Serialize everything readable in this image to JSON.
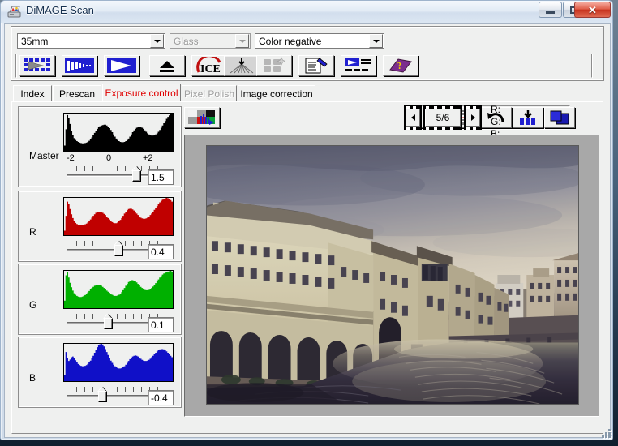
{
  "window": {
    "title": "DiMAGE Scan",
    "app_icon": "scanner-app-icon",
    "controls": {
      "minimize": "minimize-button",
      "maximize": "maximize-button",
      "close_glyph": "✕"
    }
  },
  "settings": {
    "film_format": {
      "value": "35mm",
      "enabled": true
    },
    "holder": {
      "value": "Glass",
      "enabled": false
    },
    "film_type": {
      "value": "Color negative",
      "enabled": true
    }
  },
  "main_toolbar": [
    {
      "name": "index-scan-button",
      "icon": "film-index-icon",
      "enabled": true
    },
    {
      "name": "prescan-button",
      "icon": "filmstrip-prescan-icon",
      "enabled": true
    },
    {
      "name": "scan-button",
      "icon": "scan-arrow-icon",
      "enabled": true
    },
    {
      "name": "eject-button",
      "icon": "eject-icon",
      "enabled": true
    },
    {
      "name": "digital-ice-button",
      "icon": "ice-icon",
      "enabled": true
    },
    {
      "name": "grain-dissolver-button",
      "icon": "grain-dissolver-icon",
      "enabled": true
    },
    {
      "name": "pixel-polish-button",
      "icon": "four-squares-sparkle-icon",
      "enabled": false
    },
    {
      "name": "job-save-button",
      "icon": "document-pen-icon",
      "enabled": true
    },
    {
      "name": "preferences-button",
      "icon": "settings-list-icon",
      "enabled": true
    },
    {
      "name": "help-button",
      "icon": "purple-help-book-icon",
      "enabled": true
    }
  ],
  "tabs": [
    {
      "label": "Index",
      "state": "normal"
    },
    {
      "label": "Prescan",
      "state": "normal"
    },
    {
      "label": "Exposure control",
      "state": "active"
    },
    {
      "label": "Pixel Polish",
      "state": "disabled"
    },
    {
      "label": "Image correction",
      "state": "normal"
    }
  ],
  "sub_toolbar": {
    "rgb_histogram_button": {
      "name": "rgb-histogram-button",
      "icon": "rgb-histogram-icon"
    },
    "buttons": [
      {
        "name": "load-job-button",
        "icon": "document-dropdown-icon"
      },
      {
        "name": "save-job-button",
        "icon": "document-arrow-icon"
      },
      {
        "name": "reset-button",
        "icon": "undo-arrow-icon"
      },
      {
        "name": "apply-button",
        "icon": "grid-download-icon"
      },
      {
        "name": "compare-button",
        "icon": "compare-panes-icon"
      }
    ]
  },
  "frame_nav": {
    "prev": "previous-frame-button",
    "next": "next-frame-button",
    "counter": "5/6"
  },
  "rgb_readout": {
    "r": "R:",
    "g": "G:",
    "b": "B:"
  },
  "channels": [
    {
      "id": "master",
      "label": "Master",
      "value": "1.5",
      "color": "#000000",
      "scale": {
        "min": "-2",
        "mid": "0",
        "max": "+2"
      },
      "thumb_pct": 73,
      "show_scale_labels": true,
      "histogram": [
        14,
        58,
        96,
        88,
        72,
        54,
        42,
        34,
        29,
        26,
        24,
        22,
        21,
        20,
        20,
        21,
        22,
        24,
        27,
        31,
        36,
        42,
        48,
        54,
        59,
        63,
        66,
        68,
        69,
        70,
        70,
        68,
        65,
        61,
        56,
        50,
        44,
        38,
        33,
        29,
        26,
        24,
        23,
        23,
        24,
        26,
        29,
        33,
        38,
        44,
        50,
        55,
        59,
        62,
        64,
        65,
        64,
        62,
        59,
        55,
        51,
        47,
        44,
        42,
        41,
        41,
        42,
        44,
        47,
        51,
        56,
        62,
        68,
        74,
        80,
        86,
        91,
        95,
        98,
        100
      ]
    },
    {
      "id": "r",
      "label": "R",
      "value": "0.4",
      "color": "#c00000",
      "thumb_pct": 55,
      "show_scale_labels": false,
      "histogram": [
        12,
        52,
        90,
        84,
        70,
        56,
        46,
        38,
        33,
        30,
        28,
        27,
        26,
        26,
        27,
        29,
        31,
        34,
        38,
        42,
        47,
        52,
        56,
        60,
        62,
        63,
        63,
        62,
        60,
        57,
        54,
        50,
        46,
        42,
        38,
        35,
        33,
        32,
        32,
        34,
        37,
        41,
        46,
        52,
        58,
        63,
        67,
        70,
        71,
        71,
        69,
        66,
        62,
        58,
        54,
        50,
        47,
        45,
        44,
        44,
        45,
        47,
        50,
        54,
        58,
        63,
        68,
        73,
        78,
        83,
        88,
        92,
        95,
        97,
        99,
        100,
        99,
        97,
        94,
        90
      ]
    },
    {
      "id": "g",
      "label": "G",
      "value": "0.1",
      "color": "#00b000",
      "thumb_pct": 44,
      "show_scale_labels": false,
      "histogram": [
        20,
        88,
        96,
        82,
        68,
        56,
        47,
        40,
        36,
        33,
        31,
        30,
        30,
        31,
        33,
        35,
        38,
        42,
        46,
        50,
        54,
        57,
        60,
        62,
        63,
        63,
        62,
        60,
        57,
        54,
        51,
        47,
        44,
        41,
        38,
        36,
        34,
        33,
        33,
        34,
        36,
        39,
        43,
        48,
        54,
        60,
        65,
        70,
        73,
        75,
        75,
        74,
        72,
        69,
        65,
        61,
        57,
        54,
        51,
        49,
        48,
        48,
        49,
        51,
        54,
        58,
        62,
        67,
        72,
        77,
        82,
        86,
        90,
        93,
        95,
        97,
        98,
        99,
        100,
        98
      ]
    },
    {
      "id": "b",
      "label": "B",
      "value": "-0.4",
      "color": "#1010c8",
      "thumb_pct": 38,
      "show_scale_labels": false,
      "histogram": [
        16,
        78,
        62,
        54,
        58,
        64,
        66,
        62,
        56,
        50,
        46,
        43,
        41,
        40,
        40,
        41,
        43,
        46,
        50,
        55,
        61,
        68,
        76,
        84,
        91,
        96,
        99,
        100,
        98,
        93,
        86,
        78,
        70,
        62,
        55,
        49,
        44,
        40,
        37,
        35,
        34,
        34,
        35,
        37,
        40,
        44,
        49,
        54,
        59,
        63,
        66,
        68,
        69,
        68,
        66,
        63,
        60,
        57,
        55,
        54,
        54,
        55,
        57,
        60,
        64,
        68,
        72,
        76,
        80,
        83,
        85,
        86,
        86,
        85,
        83,
        80,
        76,
        72,
        68,
        64
      ]
    }
  ],
  "image_view": {
    "name": "preview-image",
    "description": "Scanned photo of the Vasari Corridor along the Arno river, Florence, overcast sky"
  },
  "colors": {
    "active_tab_text": "#e00000",
    "face": "#eff0ef",
    "disabled_text": "#a0a0a0",
    "close_button": "#c7331e"
  }
}
